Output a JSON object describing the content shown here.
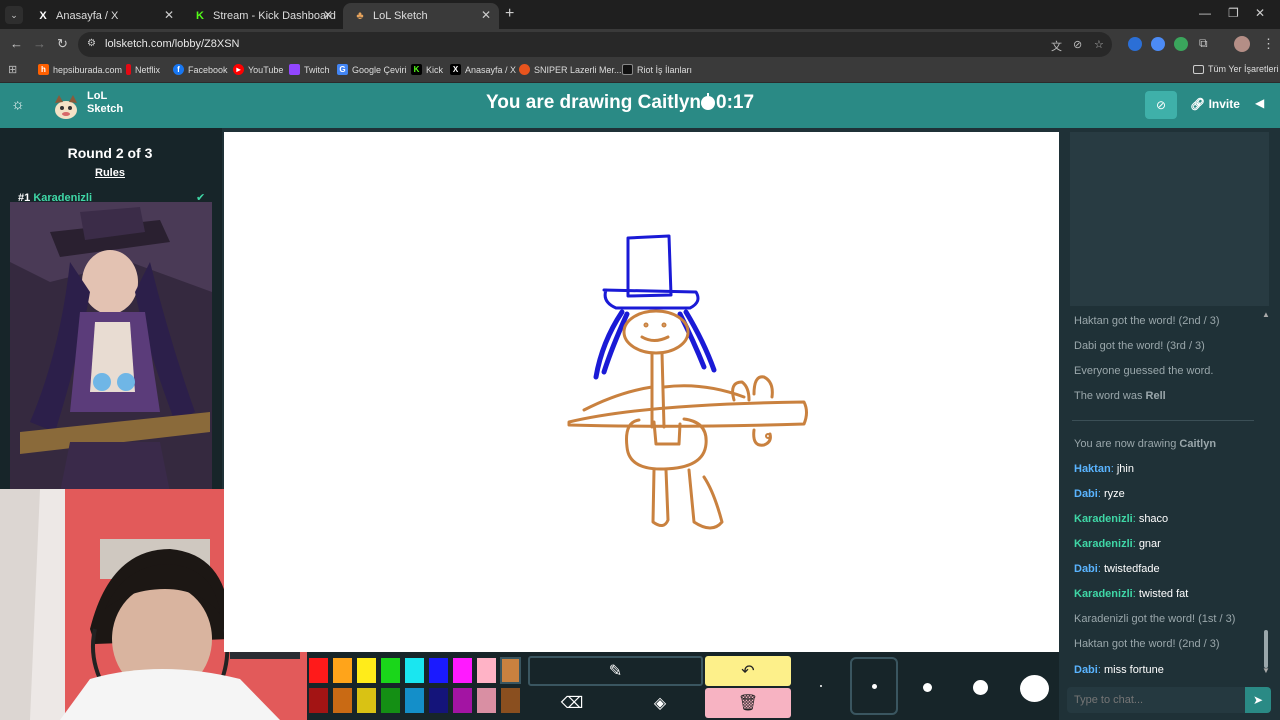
{
  "browser": {
    "tabs": [
      {
        "icon": "X",
        "title": "Anasayfa / X"
      },
      {
        "icon": "K",
        "title": "Stream - Kick Dashboard"
      },
      {
        "icon": "♣",
        "title": "LoL Sketch"
      }
    ],
    "url": "lolsketch.com/lobby/Z8XSN",
    "bookmarks": [
      {
        "title": "hepsiburada.com",
        "color": "#ff6000"
      },
      {
        "title": "Netflix",
        "color": "#e50914"
      },
      {
        "title": "Facebook",
        "color": "#1877f2"
      },
      {
        "title": "YouTube",
        "color": "#ff0000"
      },
      {
        "title": "Twitch",
        "color": "#9146ff"
      },
      {
        "title": "Google Çeviri",
        "color": "#4285f4"
      },
      {
        "title": "Kick",
        "color": "#53fc18"
      },
      {
        "title": "Anasayfa / X",
        "color": "#000000"
      },
      {
        "title": "SNIPER Lazerli Mer...",
        "color": "#e8541d"
      },
      {
        "title": "Riot İş İlanları",
        "color": "#111111"
      }
    ],
    "all_bookmarks": "Tüm Yer İşaretleri"
  },
  "app": {
    "logo_line1": "LoL",
    "logo_line2": "Sketch",
    "title_prefix": "You are drawing Caitlyn",
    "timer": "0:17",
    "invite_label": "Invite"
  },
  "left": {
    "round": "Round 2 of 3",
    "rules": "Rules",
    "rank": "#1",
    "player": "Karadenizli"
  },
  "palette": {
    "top": [
      "#ff1a1a",
      "#ffa41a",
      "#ffec1a",
      "#1ad61a",
      "#1ae6f0",
      "#1a1aff",
      "#ff1aff",
      "#ffb3c6",
      "#c9813f"
    ],
    "bottom": [
      "#a31414",
      "#c96a14",
      "#d9c214",
      "#148f14",
      "#148fc9",
      "#14147a",
      "#a314a3",
      "#d98fa3",
      "#8a4f1f"
    ]
  },
  "accent_colors": {
    "header": "#2a8a85",
    "drawing_blue": "#1a1ad6",
    "drawing_brown": "#c9813f",
    "yellow_tool": "#fdf08a",
    "pink_tool": "#f7b3c2"
  },
  "chat": {
    "messages": [
      {
        "type": "system",
        "text": "Haktan got the word! (2nd / 3)"
      },
      {
        "type": "system",
        "text": "Dabi got the word! (3rd / 3)"
      },
      {
        "type": "system",
        "text": "Everyone guessed the word."
      },
      {
        "type": "system_bold",
        "text": "The word was ",
        "bold": "Rell"
      },
      {
        "type": "system_bold",
        "text": "You are now drawing ",
        "bold": "Caitlyn"
      },
      {
        "type": "user",
        "name": "Haktan",
        "color": "#5ab4ff",
        "text": "jhin"
      },
      {
        "type": "user",
        "name": "Dabi",
        "color": "#5ab4ff",
        "text": "ryze"
      },
      {
        "type": "user",
        "name": "Karadenizli",
        "color": "#3fd7a6",
        "text": "shaco"
      },
      {
        "type": "user",
        "name": "Karadenizli",
        "color": "#3fd7a6",
        "text": "gnar"
      },
      {
        "type": "user",
        "name": "Dabi",
        "color": "#5ab4ff",
        "text": "twistedfade"
      },
      {
        "type": "user",
        "name": "Karadenizli",
        "color": "#3fd7a6",
        "text": "twisted fat"
      },
      {
        "type": "system",
        "text": "Karadenizli got the word! (1st / 3)"
      },
      {
        "type": "system",
        "text": "Haktan got the word! (2nd / 3)"
      },
      {
        "type": "user",
        "name": "Dabi",
        "color": "#5ab4ff",
        "text": "miss fortune"
      }
    ],
    "placeholder": "Type to chat..."
  }
}
